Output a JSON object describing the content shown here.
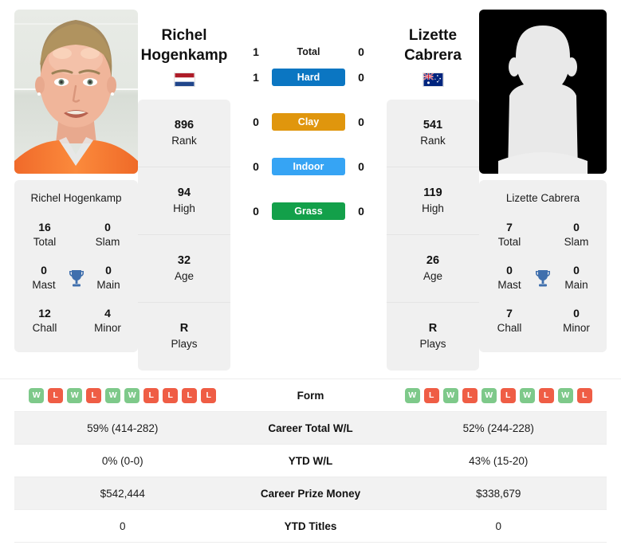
{
  "players": {
    "left": {
      "first_name": "Richel",
      "last_name": "Hogenkamp",
      "full_name": "Richel Hogenkamp",
      "country": "Netherlands",
      "flag_icon": "flag-netherlands-icon",
      "photo_type": "player-photo",
      "rank": "896",
      "high": "94",
      "age": "32",
      "plays": "R",
      "titles": {
        "total": "16",
        "slam": "0",
        "mast": "0",
        "main": "0",
        "chall": "12",
        "minor": "4"
      },
      "form": [
        "W",
        "L",
        "W",
        "L",
        "W",
        "W",
        "L",
        "L",
        "L",
        "L"
      ],
      "career_total_wl": "59% (414-282)",
      "ytd_wl": "0% (0-0)",
      "career_prize_money": "$542,444",
      "ytd_titles": "0",
      "h2h": {
        "total": "1",
        "hard": "1",
        "clay": "0",
        "indoor": "0",
        "grass": "0"
      }
    },
    "right": {
      "first_name": "Lizette",
      "last_name": "Cabrera",
      "full_name": "Lizette Cabrera",
      "country": "Australia",
      "flag_icon": "flag-australia-icon",
      "photo_type": "player-photo-placeholder",
      "rank": "541",
      "high": "119",
      "age": "26",
      "plays": "R",
      "titles": {
        "total": "7",
        "slam": "0",
        "mast": "0",
        "main": "0",
        "chall": "7",
        "minor": "0"
      },
      "form": [
        "W",
        "L",
        "W",
        "L",
        "W",
        "L",
        "W",
        "L",
        "W",
        "L"
      ],
      "career_total_wl": "52% (244-228)",
      "ytd_wl": "43% (15-20)",
      "career_prize_money": "$338,679",
      "ytd_titles": "0",
      "h2h": {
        "total": "0",
        "hard": "0",
        "clay": "0",
        "indoor": "0",
        "grass": "0"
      }
    }
  },
  "labels": {
    "rank": "Rank",
    "high": "High",
    "age": "Age",
    "plays": "Plays",
    "total": "Total",
    "slam": "Slam",
    "mast": "Mast",
    "main": "Main",
    "chall": "Chall",
    "minor": "Minor",
    "trophy_icon": "trophy-icon"
  },
  "surfaces": [
    {
      "label": "Total",
      "color": "transparent",
      "text_color": "#1b1b1b"
    },
    {
      "label": "Hard",
      "color": "#0b76c2",
      "text_color": "#ffffff"
    },
    {
      "label": "Clay",
      "color": "#e0960d",
      "text_color": "#ffffff"
    },
    {
      "label": "Indoor",
      "color": "#36a4f4",
      "text_color": "#ffffff"
    },
    {
      "label": "Grass",
      "color": "#13a04a",
      "text_color": "#ffffff"
    }
  ],
  "table_rows": [
    {
      "label": "Form",
      "type": "form"
    },
    {
      "label": "Career Total W/L",
      "type": "text",
      "left": "59% (414-282)",
      "right": "52% (244-228)"
    },
    {
      "label": "YTD W/L",
      "type": "text",
      "left": "0% (0-0)",
      "right": "43% (15-20)"
    },
    {
      "label": "Career Prize Money",
      "type": "text",
      "left": "$542,444",
      "right": "$338,679"
    },
    {
      "label": "YTD Titles",
      "type": "text",
      "left": "0",
      "right": "0"
    }
  ],
  "colors": {
    "hard": "#0b76c2",
    "clay": "#e0960d",
    "indoor": "#36a4f4",
    "grass": "#13a04a",
    "win_badge": "#7ec98a",
    "loss_badge": "#ef5d45",
    "panel_bg": "#f0f0f0",
    "row_alt_bg": "#f2f2f2",
    "trophy": "#3f6fad"
  }
}
